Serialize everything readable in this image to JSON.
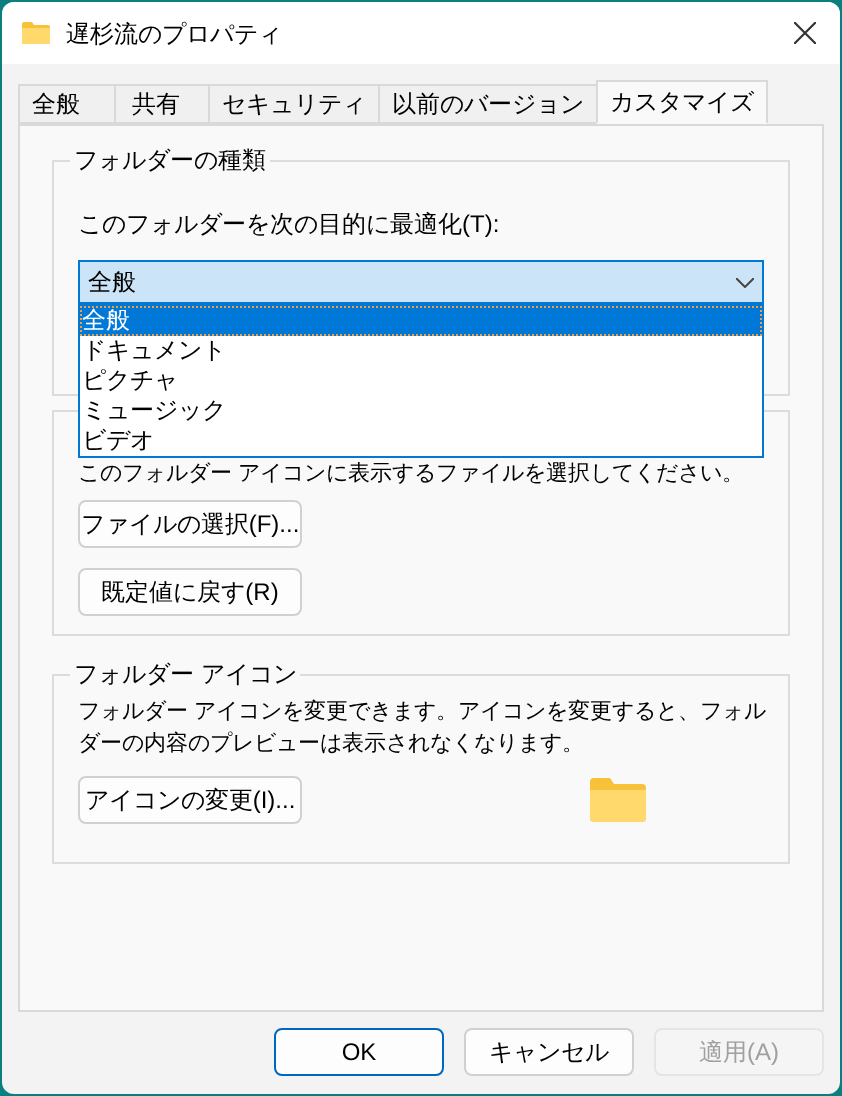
{
  "window": {
    "title": "遅杉流のプロパティ"
  },
  "tabs": [
    {
      "label": "全般",
      "selected": false
    },
    {
      "label": "共有",
      "selected": false
    },
    {
      "label": "セキュリティ",
      "selected": false
    },
    {
      "label": "以前のバージョン",
      "selected": false
    },
    {
      "label": "カスタマイズ",
      "selected": true
    }
  ],
  "folder_type": {
    "title": "フォルダーの種類",
    "label": "このフォルダーを次の目的に最適化(T):",
    "value": "全般",
    "expanded": true,
    "options": [
      {
        "label": "全般",
        "selected": true
      },
      {
        "label": "ドキュメント",
        "selected": false
      },
      {
        "label": "ピクチャ",
        "selected": false
      },
      {
        "label": "ミュージック",
        "selected": false
      },
      {
        "label": "ビデオ",
        "selected": false
      }
    ]
  },
  "folder_pictures": {
    "description": "このフォルダー アイコンに表示するファイルを選択してください。",
    "buttons": [
      "ファイルの選択(F)...",
      "既定値に戻す(R)"
    ]
  },
  "folder_icon": {
    "title": "フォルダー アイコン",
    "description": "フォルダー アイコンを変更できます。アイコンを変更すると、フォルダーの内容のプレビューは表示されなくなります。",
    "button": "アイコンの変更(I)..."
  },
  "buttons": [
    {
      "label": "OK",
      "default": true,
      "disabled": false
    },
    {
      "label": "キャンセル",
      "default": false,
      "disabled": false
    },
    {
      "label": "適用(A)",
      "default": false,
      "disabled": true
    }
  ]
}
